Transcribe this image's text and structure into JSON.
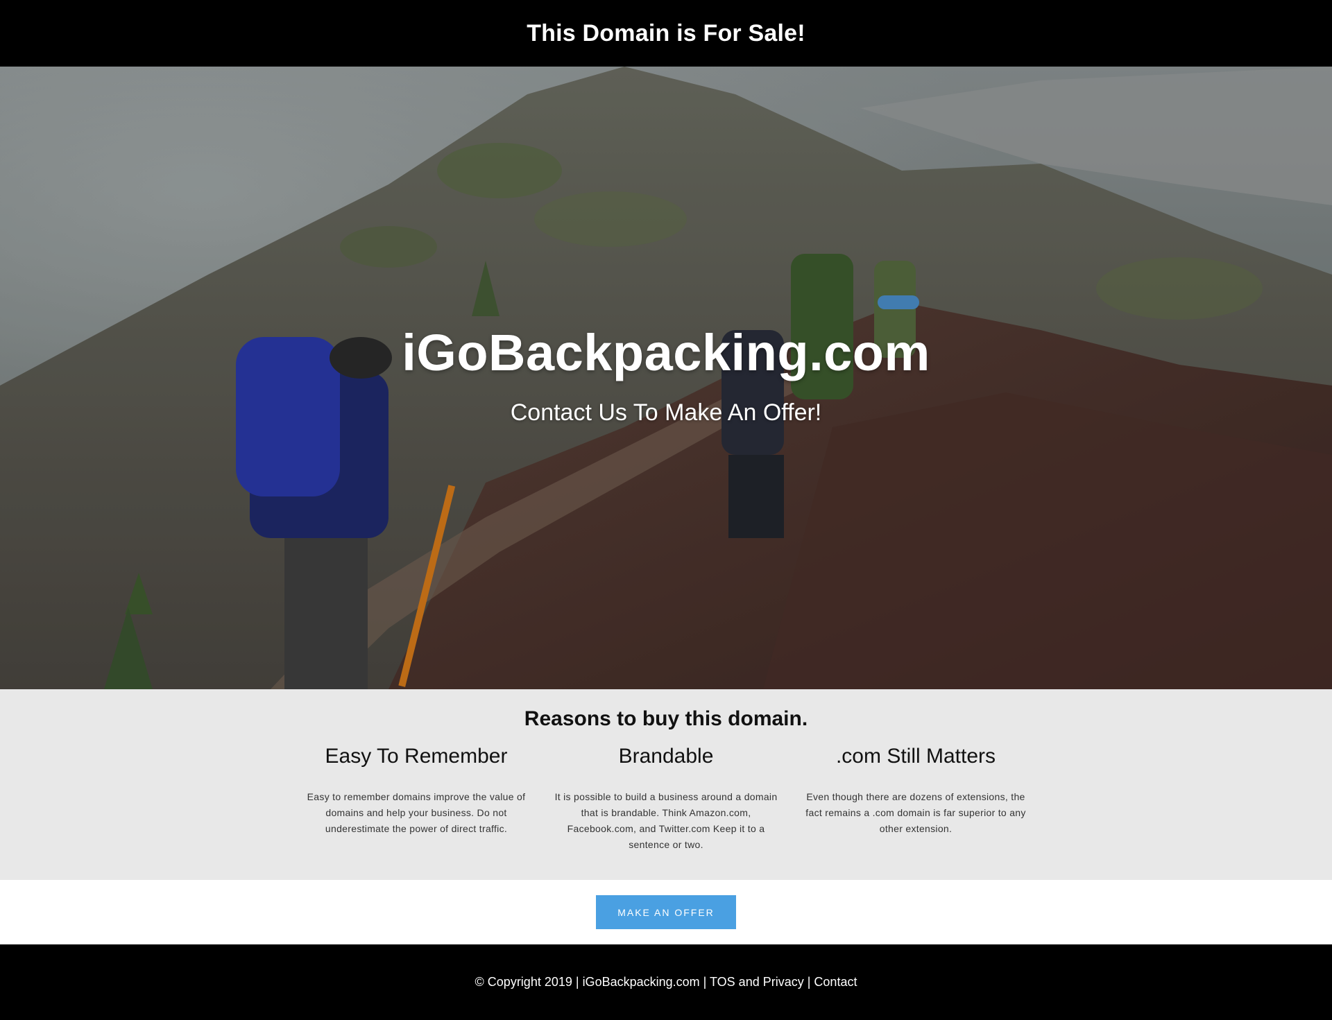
{
  "topbar": {
    "title": "This Domain is For Sale!"
  },
  "hero": {
    "title": "iGoBackpacking.com",
    "subtitle": "Contact Us To Make An Offer!"
  },
  "reasons": {
    "heading": "Reasons to buy this domain.",
    "columns": [
      {
        "title": "Easy To Remember",
        "text": "Easy to remember domains improve the value of domains and help your business. Do not underestimate the power of direct traffic."
      },
      {
        "title": "Brandable",
        "text": "It is possible to build a business around a domain that is brandable. Think Amazon.com, Facebook.com, and Twitter.com Keep it to a sentence or two."
      },
      {
        "title": ".com Still Matters",
        "text": "Even though there are dozens of extensions, the fact remains a .com domain is far superior to any other extension."
      }
    ]
  },
  "cta": {
    "label": "MAKE AN OFFER"
  },
  "footer": {
    "copyright": "© Copyright 2019 | ",
    "site_link": "iGoBackpacking.com",
    "sep1": " | ",
    "tos_link": "TOS and Privacy",
    "sep2": " | ",
    "contact_link": "Contact"
  },
  "colors": {
    "cta": "#4aa0e2",
    "bars": "#000000",
    "reasons_bg": "#e8e8e8"
  }
}
